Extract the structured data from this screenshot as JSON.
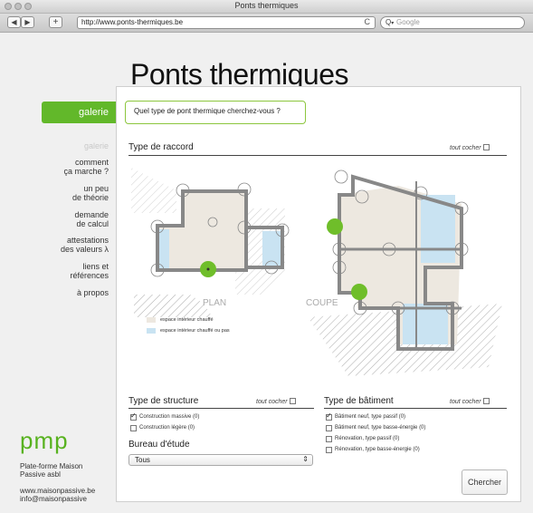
{
  "window": {
    "title": "Ponts thermiques"
  },
  "toolbar": {
    "url": "http://www.ponts-thermiques.be",
    "search_placeholder": "Google",
    "back_glyph": "◀",
    "forward_glyph": "▶",
    "add_glyph": "+",
    "reload_glyph": "C"
  },
  "page": {
    "title": "Ponts thermiques",
    "active_tab": "galerie",
    "question": "Quel type de pont thermique cherchez-vous ?"
  },
  "nav": {
    "items": [
      {
        "label": "galerie",
        "active": false
      },
      {
        "label": "comment ça marche ?",
        "line1": "comment",
        "line2": "ça marche ?"
      },
      {
        "label": "un peu de théorie",
        "line1": "un peu",
        "line2": "de théorie"
      },
      {
        "label": "demande de calcul",
        "line1": "demande",
        "line2": "de calcul"
      },
      {
        "label": "attestations des valeurs λ",
        "line1": "attestations",
        "line2": "des valeurs λ"
      },
      {
        "label": "liens et références",
        "line1": "liens et",
        "line2": "références"
      },
      {
        "label": "à propos"
      }
    ]
  },
  "raccord": {
    "title": "Type de raccord",
    "check_all": "tout cocher",
    "plan_label": "PLAN",
    "coupe_label": "COUPE",
    "legend": [
      {
        "label": "espace intérieur chauffé",
        "color": "#ede8e0"
      },
      {
        "label": "espace intérieur chauffé ou pas",
        "color": "#c9e3f2"
      }
    ],
    "highlight_color": "#6fbe2a"
  },
  "structure": {
    "title": "Type de structure",
    "check_all": "tout cocher",
    "options": [
      {
        "label": "Construction massive",
        "count": "(0)",
        "checked": true
      },
      {
        "label": "Construction légère",
        "count": "(0)",
        "checked": false
      }
    ]
  },
  "bureau": {
    "title": "Bureau d'étude",
    "selected": "Tous"
  },
  "batiment": {
    "title": "Type de bâtiment",
    "check_all": "tout cocher",
    "options": [
      {
        "label": "Bâtiment neuf, type passif",
        "count": "(0)",
        "checked": true
      },
      {
        "label": "Bâtiment neuf, type basse-énergie",
        "count": "(0)",
        "checked": false
      },
      {
        "label": "Rénovation, type passif",
        "count": "(0)",
        "checked": false
      },
      {
        "label": "Rénovation, type basse-énergie",
        "count": "(0)",
        "checked": false
      }
    ]
  },
  "actions": {
    "search_button": "Chercher"
  },
  "footer": {
    "logo": "pmp",
    "org_line1": "Plate-forme Maison",
    "org_line2": "Passive asbl",
    "website": "www.maisonpassive.be",
    "email": "info@maisonpassive"
  },
  "colors": {
    "accent_green": "#62b82a",
    "heated_space": "#ede8e0",
    "unheated_space": "#c9e3f2"
  }
}
